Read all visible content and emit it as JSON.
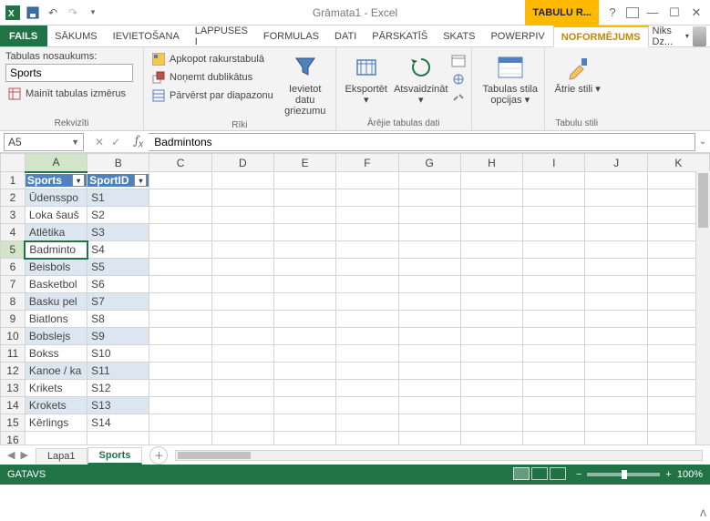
{
  "title": "Grāmata1 - Excel",
  "contextual_tab": "TABULU R...",
  "user_name": "Niks Dz...",
  "menu": {
    "file": "FAILS",
    "tabs": [
      "SĀKUMS",
      "IEVIETOŠANA",
      "LAPPUSES I",
      "FORMULAS",
      "DATI",
      "PĀRSKATĪŠ",
      "SKATS",
      "POWERPIV"
    ],
    "design": "NOFORMĒJUMS"
  },
  "ribbon": {
    "props": {
      "label": "Rekvizīti",
      "tn_label": "Tabulas nosaukums:",
      "tn_value": "Sports",
      "resize": "Mainīt tabulas izmērus"
    },
    "tools": {
      "label": "Rīki",
      "pivot": "Apkopot rakurstabulā",
      "dedup": "Noņemt dublikātus",
      "range": "Pārvērst par diapazonu",
      "slicer": "Ievietot datu griezumu"
    },
    "ext": {
      "label": "Ārējie tabulas dati",
      "export": "Eksportēt",
      "refresh": "Atsvaidzināt"
    },
    "styleopt": {
      "label": "Tabulas stila opcijas"
    },
    "styles": {
      "label": "Tabulu stili",
      "quick": "Ātrie stili"
    }
  },
  "namebox": "A5",
  "formula": "Badmintons",
  "columns": [
    "A",
    "B",
    "C",
    "D",
    "E",
    "F",
    "G",
    "H",
    "I",
    "J",
    "K"
  ],
  "active": {
    "row": 5,
    "col": 0
  },
  "headers": [
    "Sports",
    "SportID"
  ],
  "rows": [
    {
      "n": 1,
      "a": "",
      "b": ""
    },
    {
      "n": 2,
      "a": "Ūdensspo",
      "b": "S1"
    },
    {
      "n": 3,
      "a": "Loka šauš",
      "b": "S2"
    },
    {
      "n": 4,
      "a": "Atlētika",
      "b": "S3"
    },
    {
      "n": 5,
      "a": "Badminto",
      "b": "S4"
    },
    {
      "n": 6,
      "a": "Beisbols",
      "b": "S5"
    },
    {
      "n": 7,
      "a": "Basketbol",
      "b": "S6"
    },
    {
      "n": 8,
      "a": "Basku pel",
      "b": "S7"
    },
    {
      "n": 9,
      "a": "Biatlons",
      "b": "S8"
    },
    {
      "n": 10,
      "a": "Bobslejs",
      "b": "S9"
    },
    {
      "n": 11,
      "a": "Bokss",
      "b": "S10"
    },
    {
      "n": 12,
      "a": "Kanoe / ka",
      "b": "S11"
    },
    {
      "n": 13,
      "a": "Krikets",
      "b": "S12"
    },
    {
      "n": 14,
      "a": "Krokets",
      "b": "S13"
    },
    {
      "n": 15,
      "a": "Kērlings",
      "b": "S14"
    }
  ],
  "sheets": {
    "s1": "Lapa1",
    "s2": "Sports"
  },
  "status": {
    "ready": "GATAVS",
    "zoom": "100%"
  }
}
